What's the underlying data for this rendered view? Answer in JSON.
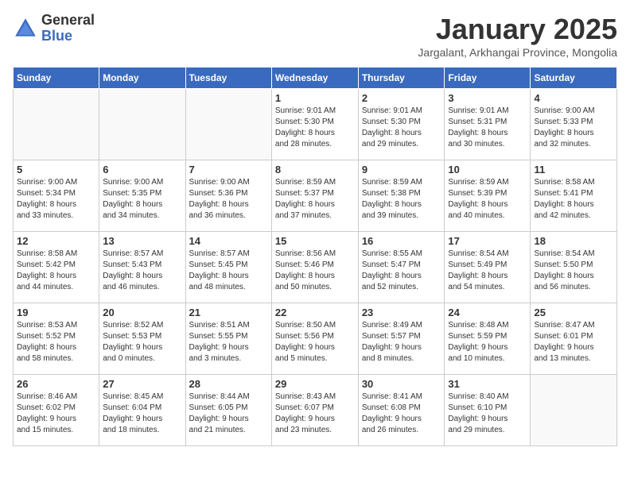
{
  "logo": {
    "general": "General",
    "blue": "Blue"
  },
  "title": "January 2025",
  "subtitle": "Jargalant, Arkhangai Province, Mongolia",
  "weekdays": [
    "Sunday",
    "Monday",
    "Tuesday",
    "Wednesday",
    "Thursday",
    "Friday",
    "Saturday"
  ],
  "weeks": [
    [
      {
        "day": "",
        "info": ""
      },
      {
        "day": "",
        "info": ""
      },
      {
        "day": "",
        "info": ""
      },
      {
        "day": "1",
        "info": "Sunrise: 9:01 AM\nSunset: 5:30 PM\nDaylight: 8 hours\nand 28 minutes."
      },
      {
        "day": "2",
        "info": "Sunrise: 9:01 AM\nSunset: 5:30 PM\nDaylight: 8 hours\nand 29 minutes."
      },
      {
        "day": "3",
        "info": "Sunrise: 9:01 AM\nSunset: 5:31 PM\nDaylight: 8 hours\nand 30 minutes."
      },
      {
        "day": "4",
        "info": "Sunrise: 9:00 AM\nSunset: 5:33 PM\nDaylight: 8 hours\nand 32 minutes."
      }
    ],
    [
      {
        "day": "5",
        "info": "Sunrise: 9:00 AM\nSunset: 5:34 PM\nDaylight: 8 hours\nand 33 minutes."
      },
      {
        "day": "6",
        "info": "Sunrise: 9:00 AM\nSunset: 5:35 PM\nDaylight: 8 hours\nand 34 minutes."
      },
      {
        "day": "7",
        "info": "Sunrise: 9:00 AM\nSunset: 5:36 PM\nDaylight: 8 hours\nand 36 minutes."
      },
      {
        "day": "8",
        "info": "Sunrise: 8:59 AM\nSunset: 5:37 PM\nDaylight: 8 hours\nand 37 minutes."
      },
      {
        "day": "9",
        "info": "Sunrise: 8:59 AM\nSunset: 5:38 PM\nDaylight: 8 hours\nand 39 minutes."
      },
      {
        "day": "10",
        "info": "Sunrise: 8:59 AM\nSunset: 5:39 PM\nDaylight: 8 hours\nand 40 minutes."
      },
      {
        "day": "11",
        "info": "Sunrise: 8:58 AM\nSunset: 5:41 PM\nDaylight: 8 hours\nand 42 minutes."
      }
    ],
    [
      {
        "day": "12",
        "info": "Sunrise: 8:58 AM\nSunset: 5:42 PM\nDaylight: 8 hours\nand 44 minutes."
      },
      {
        "day": "13",
        "info": "Sunrise: 8:57 AM\nSunset: 5:43 PM\nDaylight: 8 hours\nand 46 minutes."
      },
      {
        "day": "14",
        "info": "Sunrise: 8:57 AM\nSunset: 5:45 PM\nDaylight: 8 hours\nand 48 minutes."
      },
      {
        "day": "15",
        "info": "Sunrise: 8:56 AM\nSunset: 5:46 PM\nDaylight: 8 hours\nand 50 minutes."
      },
      {
        "day": "16",
        "info": "Sunrise: 8:55 AM\nSunset: 5:47 PM\nDaylight: 8 hours\nand 52 minutes."
      },
      {
        "day": "17",
        "info": "Sunrise: 8:54 AM\nSunset: 5:49 PM\nDaylight: 8 hours\nand 54 minutes."
      },
      {
        "day": "18",
        "info": "Sunrise: 8:54 AM\nSunset: 5:50 PM\nDaylight: 8 hours\nand 56 minutes."
      }
    ],
    [
      {
        "day": "19",
        "info": "Sunrise: 8:53 AM\nSunset: 5:52 PM\nDaylight: 8 hours\nand 58 minutes."
      },
      {
        "day": "20",
        "info": "Sunrise: 8:52 AM\nSunset: 5:53 PM\nDaylight: 9 hours\nand 0 minutes."
      },
      {
        "day": "21",
        "info": "Sunrise: 8:51 AM\nSunset: 5:55 PM\nDaylight: 9 hours\nand 3 minutes."
      },
      {
        "day": "22",
        "info": "Sunrise: 8:50 AM\nSunset: 5:56 PM\nDaylight: 9 hours\nand 5 minutes."
      },
      {
        "day": "23",
        "info": "Sunrise: 8:49 AM\nSunset: 5:57 PM\nDaylight: 9 hours\nand 8 minutes."
      },
      {
        "day": "24",
        "info": "Sunrise: 8:48 AM\nSunset: 5:59 PM\nDaylight: 9 hours\nand 10 minutes."
      },
      {
        "day": "25",
        "info": "Sunrise: 8:47 AM\nSunset: 6:01 PM\nDaylight: 9 hours\nand 13 minutes."
      }
    ],
    [
      {
        "day": "26",
        "info": "Sunrise: 8:46 AM\nSunset: 6:02 PM\nDaylight: 9 hours\nand 15 minutes."
      },
      {
        "day": "27",
        "info": "Sunrise: 8:45 AM\nSunset: 6:04 PM\nDaylight: 9 hours\nand 18 minutes."
      },
      {
        "day": "28",
        "info": "Sunrise: 8:44 AM\nSunset: 6:05 PM\nDaylight: 9 hours\nand 21 minutes."
      },
      {
        "day": "29",
        "info": "Sunrise: 8:43 AM\nSunset: 6:07 PM\nDaylight: 9 hours\nand 23 minutes."
      },
      {
        "day": "30",
        "info": "Sunrise: 8:41 AM\nSunset: 6:08 PM\nDaylight: 9 hours\nand 26 minutes."
      },
      {
        "day": "31",
        "info": "Sunrise: 8:40 AM\nSunset: 6:10 PM\nDaylight: 9 hours\nand 29 minutes."
      },
      {
        "day": "",
        "info": ""
      }
    ]
  ]
}
